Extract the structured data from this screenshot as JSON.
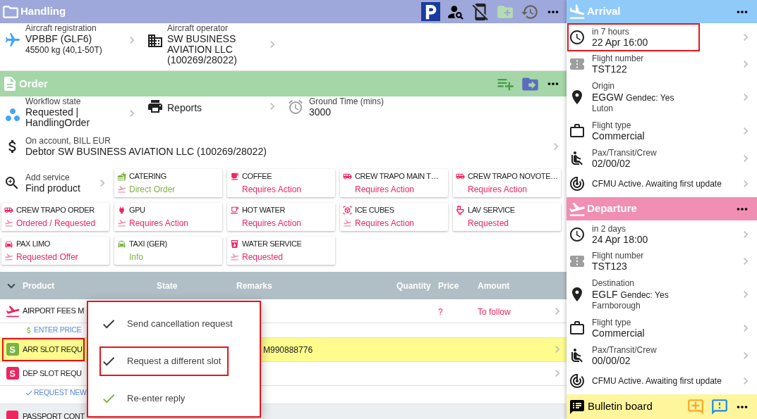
{
  "handling": {
    "title": "Handling",
    "toolbar": [
      {
        "kind": "parking",
        "disabled": false
      },
      {
        "kind": "person-search",
        "disabled": false
      },
      {
        "kind": "mobile-off",
        "disabled": false
      },
      {
        "kind": "folder-add",
        "disabled": true
      },
      {
        "kind": "history",
        "disabled": false
      },
      {
        "kind": "more",
        "disabled": false
      }
    ],
    "aircraft": {
      "label": "Aircraft registration",
      "value": "VPBBF (GLF6)",
      "detail": "45500 kg (40,1-50T)"
    },
    "operator": {
      "label": "Aircraft operator",
      "value": "SW BUSINESS AVIATION LLC (100269/28022)"
    }
  },
  "order": {
    "title": "Order",
    "toolbar": [
      {
        "kind": "playlist-add"
      },
      {
        "kind": "folder-move"
      },
      {
        "kind": "more"
      }
    ],
    "workflow": {
      "label": "Workflow state",
      "value": "Requested | HandlingOrder"
    },
    "reports": {
      "label": "Reports"
    },
    "ground_time": {
      "label": "Ground Time (mins)",
      "value": "3000"
    },
    "account": {
      "label": "On account, BILL EUR",
      "value": "Debtor SW BUSINESS AVIATION LLC (100269/28022)"
    },
    "add_service": {
      "label": "Add service",
      "value": "Find product"
    },
    "services": [
      {
        "name": "CATERING",
        "kind": "catering",
        "status": "Direct Order",
        "color": "#7cb342",
        "departure": true
      },
      {
        "name": "COFFEE",
        "kind": "coffee",
        "status": "Requires Action",
        "color": "#f0245f",
        "departure": false
      },
      {
        "name": "CREW TRAPO MAIN T…",
        "kind": "bus",
        "status": "Requires Action",
        "color": "#f0245f",
        "departure": false
      },
      {
        "name": "CREW TRAPO NOVOTE…",
        "kind": "bus",
        "status": "Requires Action",
        "color": "#f0245f",
        "departure": false
      },
      {
        "name": "CREW TRAPO ORDER",
        "kind": "bus",
        "status": "Ordered / Requested",
        "color": "#f0245f",
        "departure": true
      },
      {
        "name": "GPU",
        "kind": "plug",
        "status": "Requires Action",
        "color": "#f0245f",
        "departure": true
      },
      {
        "name": "HOT WATER",
        "kind": "hot-drink",
        "status": "Requires Action",
        "color": "#f0245f",
        "departure": false
      },
      {
        "name": "ICE CUBES",
        "kind": "cube",
        "status": "Requires Action",
        "color": "#f0245f",
        "departure": true
      },
      {
        "name": "LAV SERVICE",
        "kind": "toilet",
        "status": "Requested",
        "color": "#f0245f",
        "departure": false
      },
      {
        "name": "PAX LIMO",
        "kind": "car",
        "status": "Requested Offer",
        "color": "#f0245f",
        "departure": true
      },
      {
        "name": "TAXI (GER)",
        "kind": "taxi",
        "status": "Info",
        "color": "#7cb342",
        "departure": false
      },
      {
        "name": "WATER SERVICE",
        "kind": "water",
        "status": "Requested",
        "color": "#f0245f",
        "departure": true
      }
    ]
  },
  "products": {
    "expanded": true,
    "columns": [
      "Product",
      "State",
      "Remarks",
      "Quantity",
      "Price",
      "Amount"
    ],
    "rows": [
      {
        "kind": "fee",
        "name": "AIRPORT FEES M",
        "price": "?",
        "amount": "To follow",
        "selected": false,
        "highlighted": false
      },
      {
        "kind": "price-action",
        "label": "ENTER PRICE",
        "selected": false,
        "highlighted": false
      },
      {
        "kind": "slot",
        "badge": "S",
        "color": "#7cb342",
        "name": "ARR SLOT REQU",
        "remarks": "M990888776",
        "selected": true,
        "highlighted": true
      },
      {
        "kind": "slot",
        "badge": "S",
        "color": "#f0245f",
        "name": "DEP SLOT REQU",
        "selected": false,
        "highlighted": false
      },
      {
        "kind": "request-action",
        "label": "REQUEST NEW",
        "selected": false,
        "highlighted": false
      },
      {
        "kind": "group",
        "name": "PASSPORT CONT",
        "selected": false,
        "highlighted": false
      }
    ]
  },
  "context_menu": {
    "highlighted": true,
    "items": [
      {
        "label": "Send cancellation request",
        "color": "#333333",
        "highlighted": false
      },
      {
        "label": "Request a different slot",
        "color": "#333333",
        "highlighted": true
      },
      {
        "label": "Re-enter reply",
        "color": "#7cb342",
        "highlighted": false
      }
    ]
  },
  "flights": [
    {
      "kind": "arrival",
      "title": "Arrival",
      "rows": [
        {
          "kind": "time",
          "label": "in 7 hours",
          "value": "22 Apr 16:00",
          "highlighted": true
        },
        {
          "kind": "flight-number",
          "label": "Flight number",
          "value": "TST122",
          "highlighted": false
        },
        {
          "kind": "place",
          "label": "Origin",
          "value": "EGGW",
          "note": "Gendec: Yes",
          "detail": "Luton",
          "highlighted": false
        },
        {
          "kind": "flight-type",
          "label": "Flight type",
          "value": "Commercial",
          "highlighted": false
        },
        {
          "kind": "pax",
          "label": "Pax/Transit/Crew",
          "value": "02/00/02",
          "highlighted": false
        },
        {
          "kind": "cfmu",
          "value": "CFMU Active. Awaiting first update",
          "highlighted": false
        }
      ]
    },
    {
      "kind": "departure",
      "title": "Departure",
      "rows": [
        {
          "kind": "time",
          "label": "in 2 days",
          "value": "24 Apr 18:00",
          "highlighted": false
        },
        {
          "kind": "flight-number",
          "label": "Flight number",
          "value": "TST123",
          "highlighted": false
        },
        {
          "kind": "place",
          "label": "Destination",
          "value": "EGLF",
          "note": "Gendec: Yes",
          "detail": "Farnborough",
          "highlighted": false
        },
        {
          "kind": "flight-type",
          "label": "Flight type",
          "value": "Commercial",
          "highlighted": false
        },
        {
          "kind": "pax",
          "label": "Pax/Transit/Crew",
          "value": "00/00/02",
          "highlighted": false
        },
        {
          "kind": "cfmu",
          "value": "CFMU Active. Awaiting first update",
          "highlighted": false
        }
      ]
    }
  ],
  "bulletin_board": {
    "title": "Bulletin board",
    "toolbar": [
      {
        "kind": "add-comment"
      },
      {
        "kind": "feedback"
      },
      {
        "kind": "more"
      }
    ]
  }
}
